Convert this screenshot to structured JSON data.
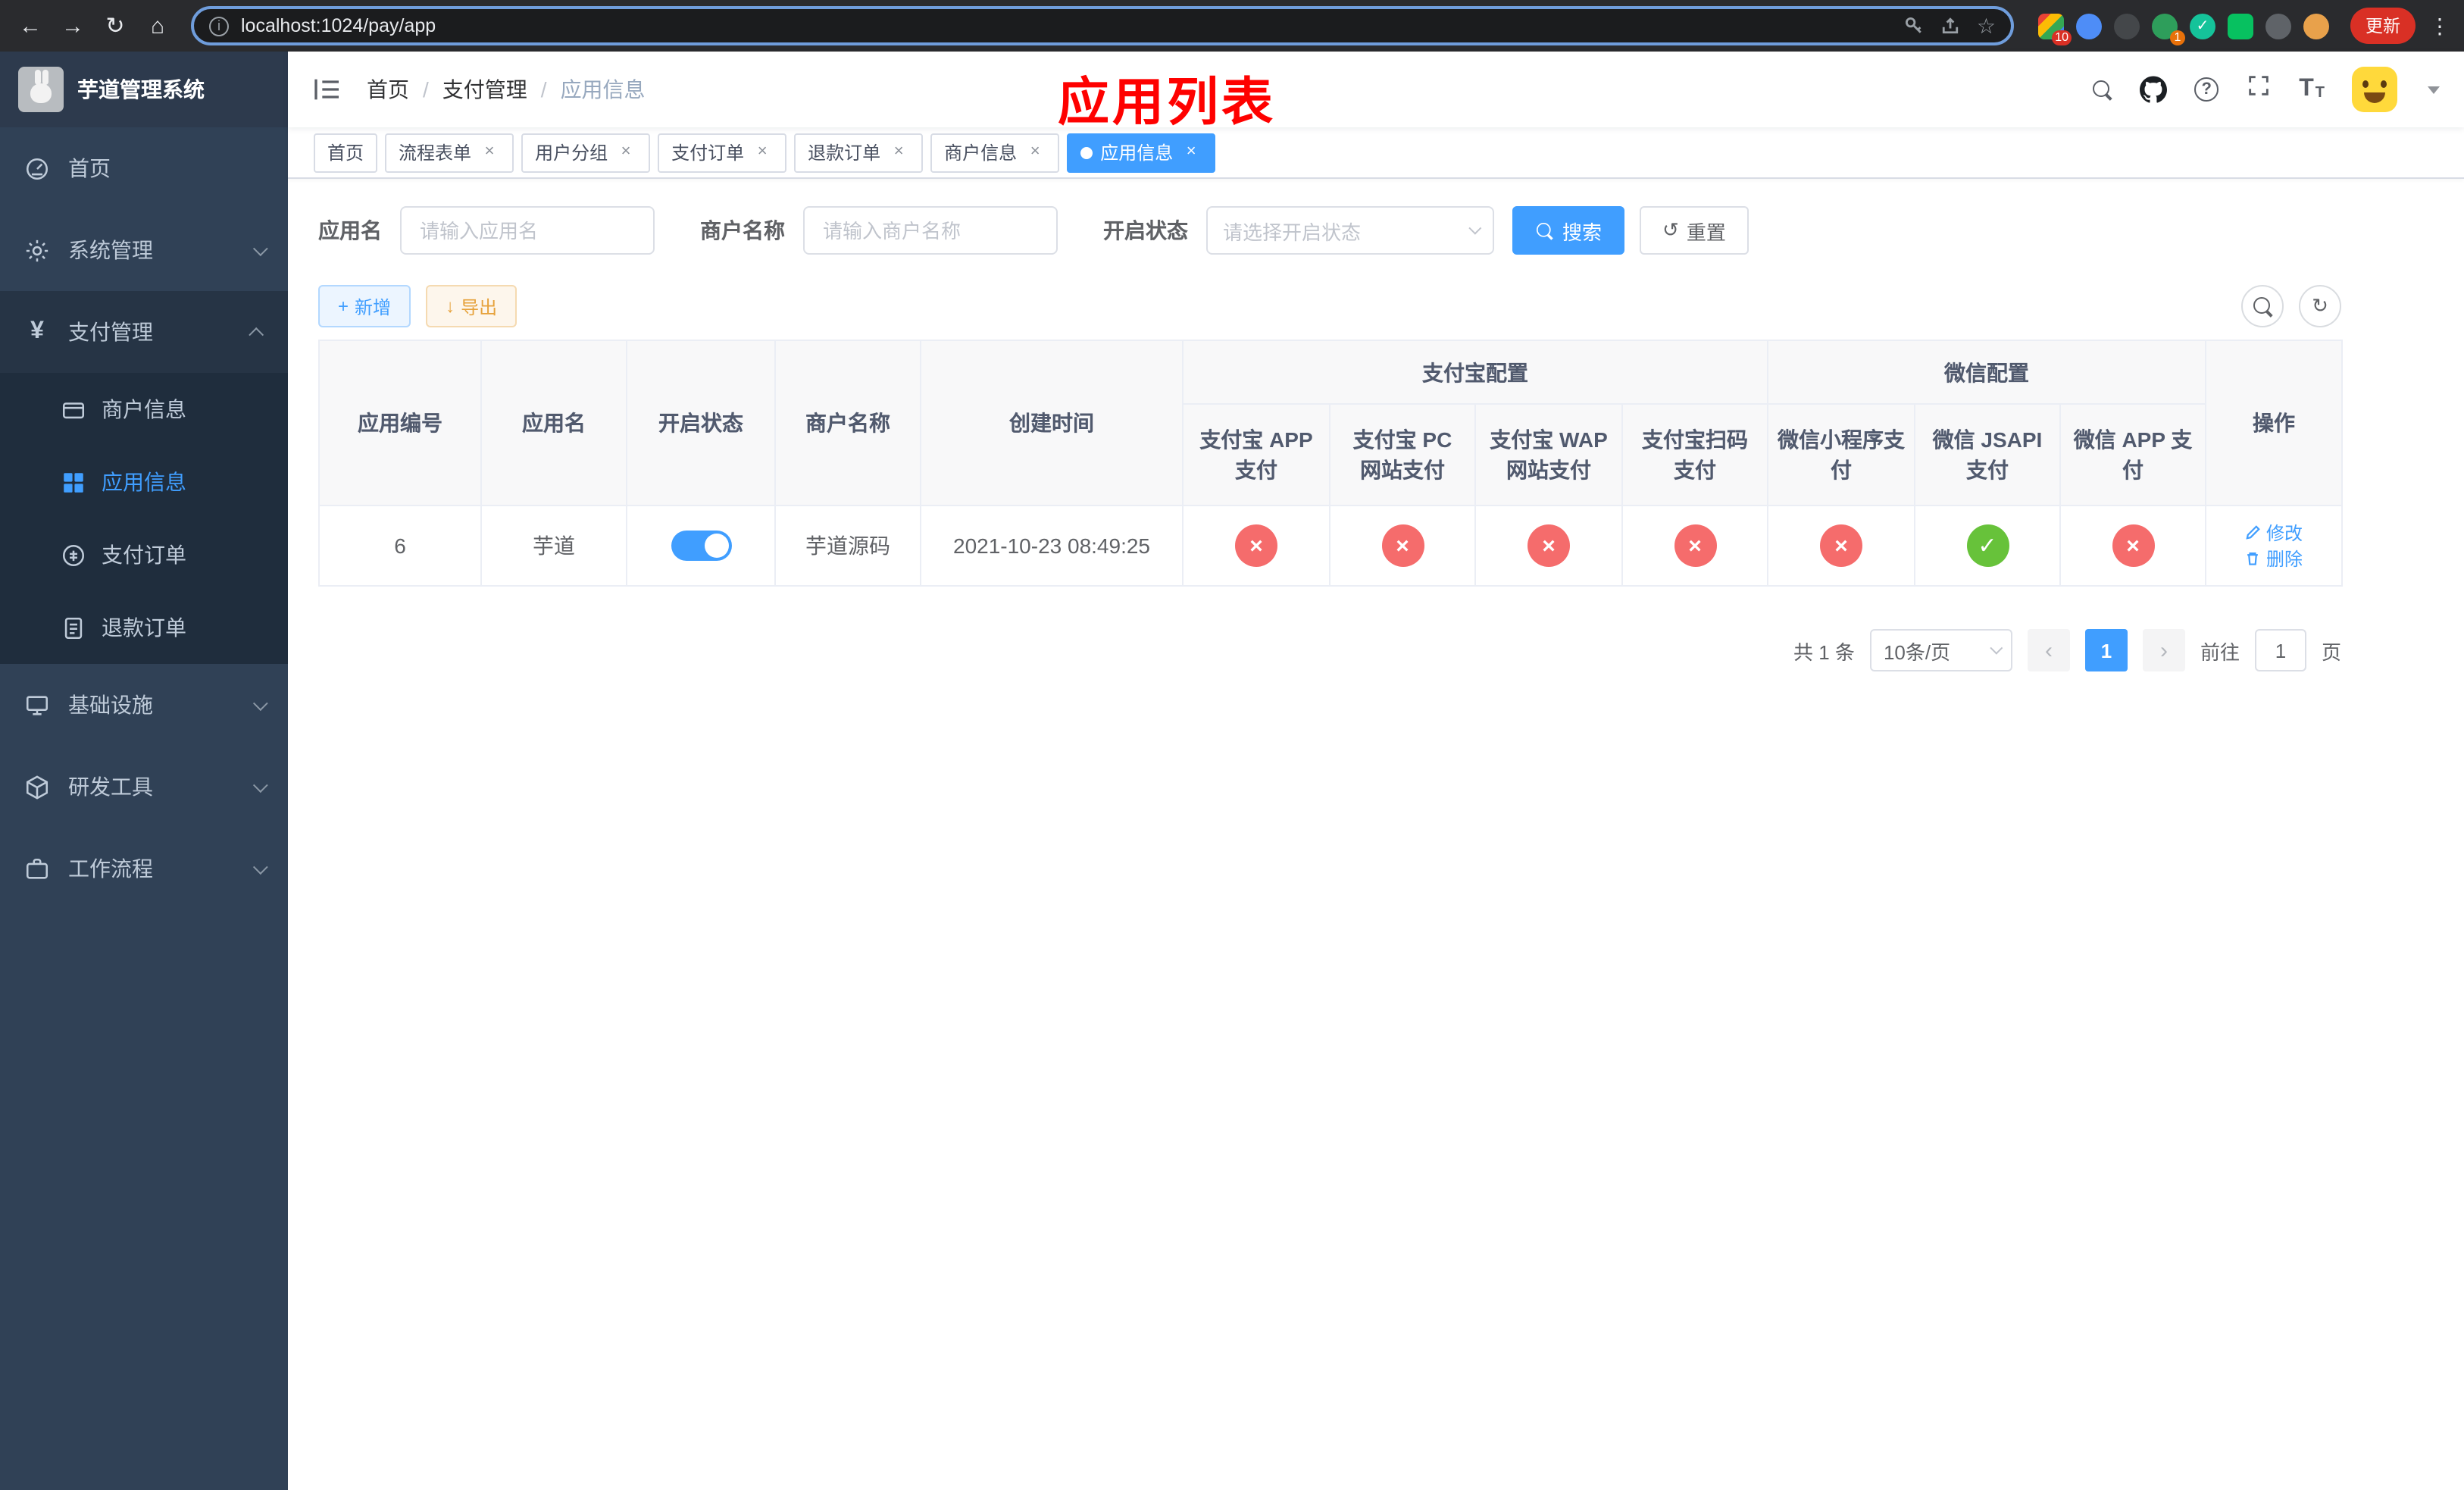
{
  "colors": {
    "primary": "#409eff",
    "success": "#67c23a",
    "danger": "#f56c6c",
    "warning": "#e6a23c",
    "overlay_red": "#fe0100",
    "sidebar_bg": "#304156"
  },
  "browser": {
    "url": "localhost:1024/pay/app",
    "update_button": "更新",
    "extensions_badge": "10",
    "avatar_badge": "1"
  },
  "overlay": {
    "title": "应用列表"
  },
  "sidebar": {
    "app_title": "芋道管理系统",
    "items": {
      "home": "首页",
      "system": "系统管理",
      "payment": "支付管理",
      "merchant": "商户信息",
      "appinfo": "应用信息",
      "payorder": "支付订单",
      "refund": "退款订单",
      "infra": "基础设施",
      "devtools": "研发工具",
      "workflow": "工作流程"
    }
  },
  "breadcrumb": [
    "首页",
    "支付管理",
    "应用信息"
  ],
  "tabs": [
    {
      "label": "首页",
      "closable": false,
      "active": false
    },
    {
      "label": "流程表单",
      "closable": true,
      "active": false
    },
    {
      "label": "用户分组",
      "closable": true,
      "active": false
    },
    {
      "label": "支付订单",
      "closable": true,
      "active": false
    },
    {
      "label": "退款订单",
      "closable": true,
      "active": false
    },
    {
      "label": "商户信息",
      "closable": true,
      "active": false
    },
    {
      "label": "应用信息",
      "closable": true,
      "active": true
    }
  ],
  "filter": {
    "app_name_label": "应用名",
    "app_name_placeholder": "请输入应用名",
    "merchant_label": "商户名称",
    "merchant_placeholder": "请输入商户名称",
    "status_label": "开启状态",
    "status_placeholder": "请选择开启状态",
    "search": "搜索",
    "reset": "重置"
  },
  "toolbar": {
    "add": "新增",
    "export": "导出"
  },
  "table": {
    "col_app_id": "应用编号",
    "col_app_name": "应用名",
    "col_status": "开启状态",
    "col_merchant": "商户名称",
    "col_created": "创建时间",
    "group_alipay": "支付宝配置",
    "group_wechat": "微信配置",
    "col_alipay_app": "支付宝 APP 支付",
    "col_alipay_pc": "支付宝 PC 网站支付",
    "col_alipay_wap": "支付宝 WAP 网站支付",
    "col_alipay_qr": "支付宝扫码支付",
    "col_wx_mini": "微信小程序支付",
    "col_wx_jsapi": "微信 JSAPI 支付",
    "col_wx_app": "微信 APP 支付",
    "col_actions": "操作",
    "row": {
      "id": "6",
      "name": "芋道",
      "status_on": true,
      "merchant": "芋道源码",
      "created": "2021-10-23 08:49:25",
      "channels": {
        "alipay_app": false,
        "alipay_pc": false,
        "alipay_wap": false,
        "alipay_qr": false,
        "wx_mini": false,
        "wx_jsapi": true,
        "wx_app": false
      }
    },
    "action_edit": "修改",
    "action_delete": "删除"
  },
  "pagination": {
    "total": "共 1 条",
    "page_size": "10条/页",
    "page": "1",
    "goto": "前往",
    "goto_value": "1",
    "unit": "页"
  },
  "ui": {
    "close": "×",
    "check": "✓",
    "cross": "×",
    "prev": "‹",
    "next": "›",
    "more": "⋮",
    "star": "☆",
    "back": "←",
    "forward": "→",
    "reload": "↻",
    "home": "⌂",
    "info": "i",
    "question": "?",
    "plus": "+",
    "download": "↓",
    "reset_icon": "↺",
    "refresh_icon": "↻",
    "t": "T"
  }
}
